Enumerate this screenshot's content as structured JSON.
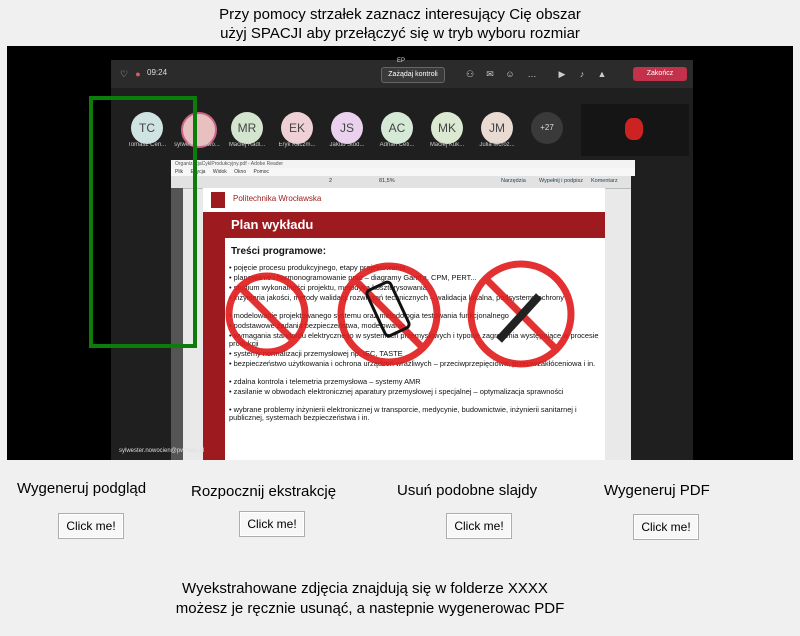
{
  "instructions": {
    "line1": "Przy pomocy strzałek zaznacz interesujący Cię obszar",
    "line2": "użyj SPACJI aby przełączyć się w tryb wyboru rozmiar"
  },
  "preview": {
    "teams": {
      "window_title": "EP",
      "time": "09:24",
      "control_button": "Zażądaj kontroli",
      "leave_button": "Zakończ",
      "participants": [
        {
          "initials": "TC",
          "name": "Tomasz Cen...",
          "color": "#cfe3e3"
        },
        {
          "initials": "",
          "name": "sylwester.nowo...",
          "color": "#e8c0c0"
        },
        {
          "initials": "MR",
          "name": "Maciej Radl...",
          "color": "#d3e5cf"
        },
        {
          "initials": "EK",
          "name": "Eryk Kaczm...",
          "color": "#efd0d6"
        },
        {
          "initials": "JS",
          "name": "Jakub Stod...",
          "color": "#ead2ee"
        },
        {
          "initials": "AC",
          "name": "Adrian Ceti...",
          "color": "#d6e9d6"
        },
        {
          "initials": "MK",
          "name": "Maciej Kuk...",
          "color": "#dbe9d2"
        },
        {
          "initials": "JM",
          "name": "Julia Mcroz...",
          "color": "#eadbd2"
        },
        {
          "initials": "+27",
          "name": "",
          "color": "#3a3a3a"
        }
      ],
      "presenter_email": "sylwester.nowocien@pwr.edu.pl"
    },
    "reader": {
      "title": "OrganizacjaCyklProdukcyjny.pdf - Adobe Reader",
      "menu": [
        "Plik",
        "Edycja",
        "Widok",
        "Okno",
        "Pomoc"
      ],
      "tools": [
        "Narzędzia",
        "Wypełnij i podpisz",
        "Komentarz"
      ],
      "zoom": "81,5%",
      "page_field": "2"
    },
    "slide": {
      "institution": "Politechnika Wrocławska",
      "title": "Plan wykładu",
      "section": "Treści programowe:",
      "page": "2",
      "bullets": [
        "pojęcie procesu produkcyjnego, etapy projektowania",
        "planowanie i harmonogramowanie prac – diagramy Gantt'a, CPM, PERT...",
        "studium wykonalności projektu, metodyka kosztorysowania",
        "inżynieria jakości, metody walidacji rozwiązań technicznych – walidacja lokalna, podsystemy ochrony",
        "modelowanie projektowanego systemu oraz metodologia testowania funkcjonalnego",
        "podstawowe zadania bezpieczeństwa, modelowanie",
        "wymagania standardu elektrycznego w systemach przemysłowych i typowe zagrożenia występujące w procesie produkcji",
        "systemy normalizacji przemysłowej np. IEC, TASTE",
        "bezpieczeństwo użytkowania i ochrona urządzeń wrażliwych – przeciwprzepięciowa, przeciwzakłóceniowa i in.",
        "zdalna kontrola i telemetria przemysłowa – systemy AMR",
        "zasilanie w obwodach elektronicznej aparatury przemysłowej i specjalnej – optymalizacja sprawności",
        "wybrane problemy inżynierii elektronicznej w transporcie, medycynie, budownictwie, inżynierii sanitarnej i publicznej, systemach bezpieczeństwa i in."
      ]
    }
  },
  "actions": [
    {
      "label": "Wygeneruj podgląd",
      "button": "Click me!"
    },
    {
      "label": "Rozpocznij ekstrakcję",
      "button": "Click me!"
    },
    {
      "label": "Usuń podobne slajdy",
      "button": "Click me!"
    },
    {
      "label": "Wygeneruj PDF",
      "button": "Click me!"
    }
  ],
  "footer": {
    "line1": "Wyekstrahowane zdjęcia znajdują się w folderze XXXX",
    "line2": "możesz je ręcznie usunąć, a nastepnie wygenerowac PDF"
  }
}
